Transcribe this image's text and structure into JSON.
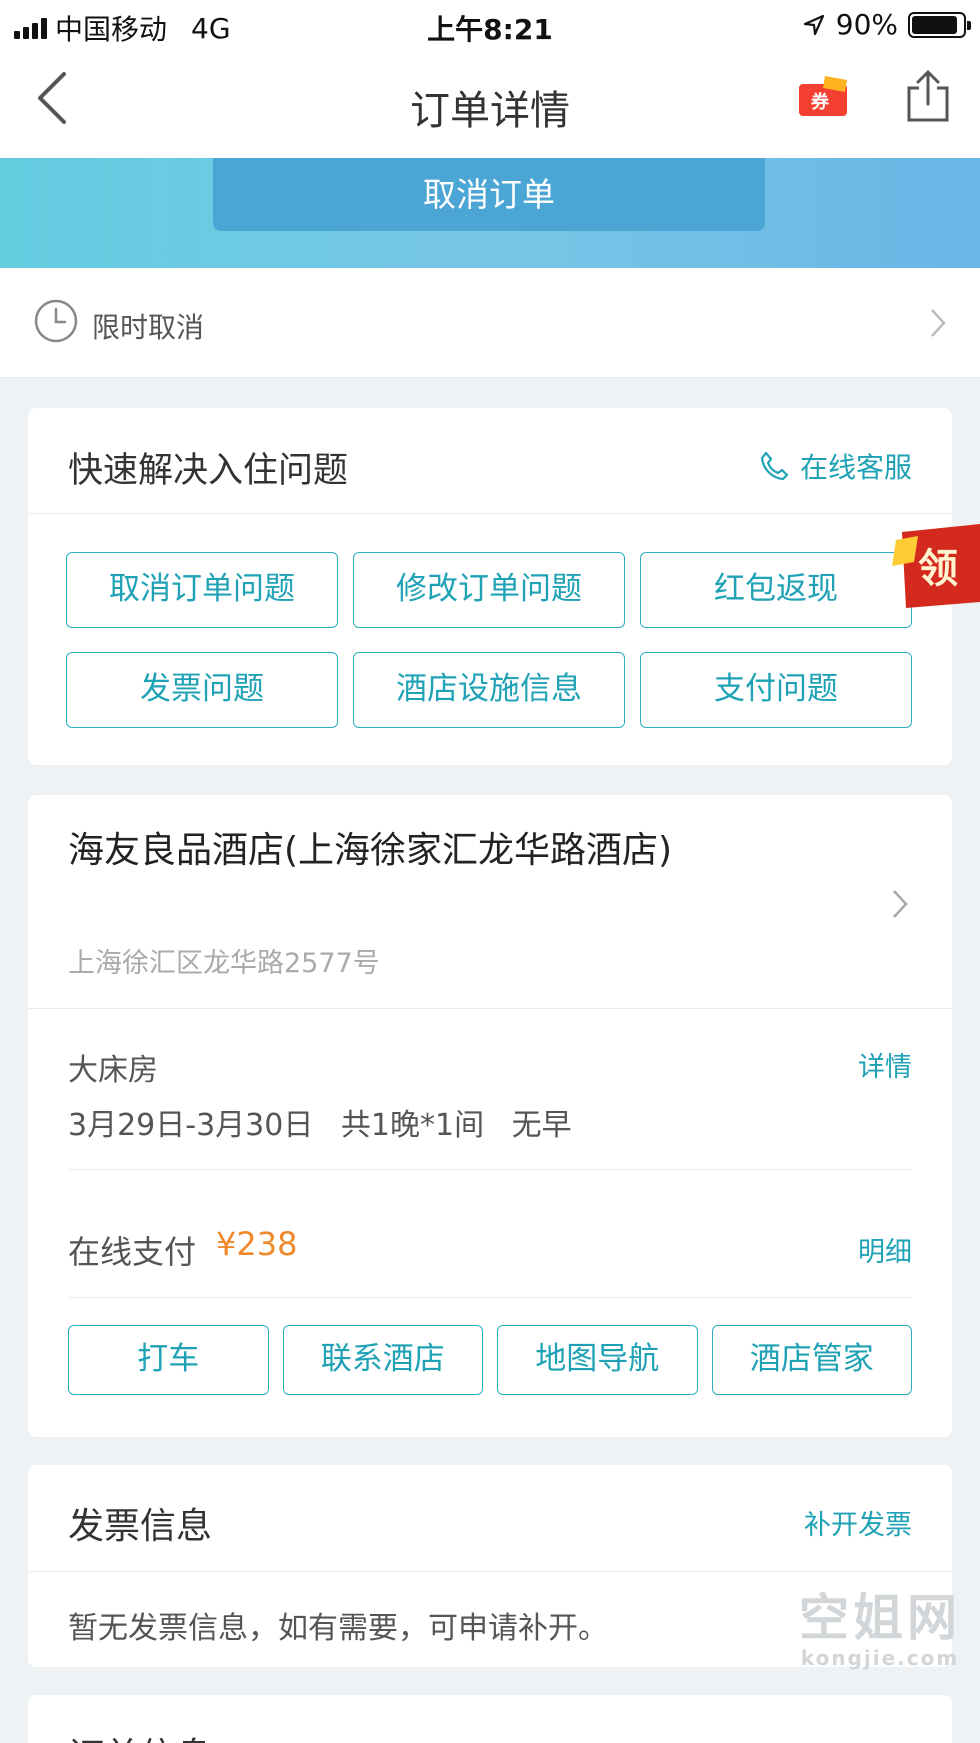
{
  "status_bar": {
    "carrier": "中国移动",
    "network": "4G",
    "time": "上午8:21",
    "battery": "90%",
    "battery_level": 0.9
  },
  "nav": {
    "title": "订单详情",
    "coupon_label": "券"
  },
  "banner": {
    "cancel_label": "取消订单"
  },
  "limit_cancel": {
    "label": "限时取消"
  },
  "help": {
    "title": "快速解决入住问题",
    "service_label": "在线客服",
    "buttons": [
      "取消订单问题",
      "修改订单问题",
      "红包返现",
      "发票问题",
      "酒店设施信息",
      "支付问题"
    ],
    "badge_text": "领"
  },
  "hotel": {
    "name": "海友良品酒店(上海徐家汇龙华路酒店)",
    "address": "上海徐汇区龙华路2577号",
    "room_type": "大床房",
    "detail_link": "详情",
    "dates": "3月29日-3月30日",
    "nights": "共1晚*1间",
    "breakfast": "无早",
    "pay_label": "在线支付",
    "pay_price": "¥238",
    "pay_link": "明细",
    "actions": [
      "打车",
      "联系酒店",
      "地图导航",
      "酒店管家"
    ]
  },
  "invoice": {
    "title": "发票信息",
    "link": "补开发票",
    "text": "暂无发票信息，如有需要，可申请补开。"
  },
  "next_section": {
    "title": "订单信息"
  },
  "watermark": {
    "cn": "空姐网",
    "en": "kongjie.com"
  },
  "colors": {
    "accent": "#1fa2b5",
    "price": "#ef8a2c",
    "banner_button": "#4ba6d6"
  }
}
